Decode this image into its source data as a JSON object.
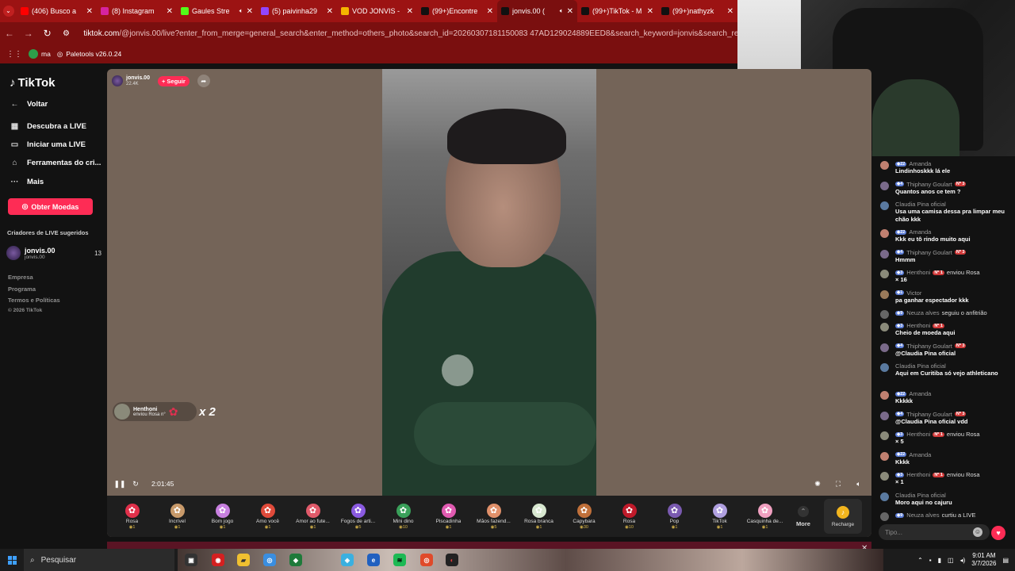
{
  "browser": {
    "tabs": [
      {
        "title": "(406) Busco a",
        "icon": "youtube-icon",
        "color": "#ff0000",
        "sound": false
      },
      {
        "title": "(8) Instagram",
        "icon": "instagram-icon",
        "color": "#d6249f",
        "sound": false
      },
      {
        "title": "Gaules Stre",
        "icon": "kick-icon",
        "color": "#53fc18",
        "sound": true
      },
      {
        "title": "(5) paivinha29",
        "icon": "twitch-icon",
        "color": "#9146ff",
        "sound": false
      },
      {
        "title": "VOD JONVIS -",
        "icon": "drive-icon",
        "color": "#f4b400",
        "sound": false
      },
      {
        "title": "(99+)Encontre",
        "icon": "tiktok-icon",
        "color": "#111111",
        "sound": false
      },
      {
        "title": "jonvis.00 (",
        "icon": "tiktok-icon",
        "color": "#111111",
        "sound": true,
        "active": true
      },
      {
        "title": "(99+)TikTok - M",
        "icon": "tiktok-icon",
        "color": "#111111",
        "sound": false
      },
      {
        "title": "(99+)nathyzk",
        "icon": "tiktok-icon",
        "color": "#111111",
        "sound": false
      }
    ],
    "url_host": "tiktok.com",
    "url_path": "/@jonvis.00/live?enter_from_merge=general_search&enter_method=others_photo&search_id=20260307181150083 47AD129024889EED8&search_keyword=jonvis&search_result_id=2422438",
    "bookmarks": [
      {
        "label": "ma",
        "color": "#2e9e4a"
      },
      {
        "label": "Paletools v26.0.24",
        "color": "#ffffff"
      }
    ]
  },
  "sidebar": {
    "brand": "TikTok",
    "nav": [
      {
        "label": "Voltar",
        "icon": "arrow-left-icon"
      },
      {
        "label": "Descubra a LIVE",
        "icon": "live-calendar-icon"
      },
      {
        "label": "Iniciar uma LIVE",
        "icon": "camera-icon"
      },
      {
        "label": "Ferramentas do cri...",
        "icon": "home-icon"
      },
      {
        "label": "Mais",
        "icon": "more-icon"
      }
    ],
    "coins_button": "Obter Moedas",
    "suggested_heading": "Criadores de LIVE sugeridos",
    "creator": {
      "name": "jonvis.00",
      "handle": "jonvis.00",
      "count": "13"
    },
    "footer": [
      "Empresa",
      "Programa",
      "Termos e Políticas",
      "© 2026 TikTok"
    ]
  },
  "live": {
    "host_name": "jonvis.00",
    "viewers": "22.4K",
    "follow_label": "+ Seguir",
    "gift_popup": {
      "user": "Henthoni",
      "text": "enviou Rosa n°",
      "multiplier": "x 2"
    },
    "elapsed": "2:01:45"
  },
  "gifts": [
    {
      "name": "Rosa",
      "price": "1",
      "icon": "rose-icon",
      "color": "#e0304a"
    },
    {
      "name": "Incrível",
      "price": "1",
      "icon": "face-icon",
      "color": "#c89a6a"
    },
    {
      "name": "Bom jogo",
      "price": "1",
      "icon": "gamepad-icon",
      "color": "#c880e0"
    },
    {
      "name": "Amo você",
      "price": "1",
      "icon": "heart-icon",
      "color": "#e04a3a"
    },
    {
      "name": "Amor ao fute...",
      "price": "1",
      "icon": "football-icon",
      "color": "#e05a6a"
    },
    {
      "name": "Fogos de arti...",
      "price": "5",
      "icon": "fireworks-icon",
      "color": "#8a5ae0"
    },
    {
      "name": "Mini dino",
      "price": "10",
      "icon": "dino-icon",
      "color": "#3aa05a"
    },
    {
      "name": "Piscadinha",
      "price": "1",
      "icon": "wink-icon",
      "color": "#e05ab0"
    },
    {
      "name": "Mãos fazend...",
      "price": "5",
      "icon": "hands-icon",
      "color": "#e0906a"
    },
    {
      "name": "Rosa branca",
      "price": "1",
      "icon": "white-rose-icon",
      "color": "#d8e8d0"
    },
    {
      "name": "Capybara",
      "price": "30",
      "icon": "capybara-icon",
      "color": "#c0703a"
    },
    {
      "name": "Rosa",
      "price": "10",
      "icon": "rose-icon",
      "color": "#c01a2a"
    },
    {
      "name": "Pop",
      "price": "1",
      "icon": "pop-icon",
      "color": "#7a5ab0"
    },
    {
      "name": "TikTok",
      "price": "1",
      "icon": "tiktok-icon",
      "color": "#b0a0e0"
    },
    {
      "name": "Casquinha de...",
      "price": "1",
      "icon": "icecream-icon",
      "color": "#f0a0c0"
    }
  ],
  "gift_more": "More",
  "recharge": "Recharge",
  "chat": [
    {
      "lvl": "22",
      "user": "Amanda",
      "badge": "",
      "text": "Lindinhoskkk lá ele",
      "action": ""
    },
    {
      "lvl": "4",
      "user": "Thiphany Goulart",
      "badge": "Nº 3",
      "text": "Quantos anos ce tem ?",
      "action": ""
    },
    {
      "lvl": "",
      "user": "Claudia Pina oficial",
      "badge": "",
      "text": "Usa uma camisa dessa pra limpar meu chão kkk",
      "action": ""
    },
    {
      "lvl": "22",
      "user": "Amanda",
      "badge": "",
      "text": "Kkk eu tô rindo muito aqui",
      "action": ""
    },
    {
      "lvl": "4",
      "user": "Thiphany Goulart",
      "badge": "Nº 3",
      "text": "Hmmm",
      "action": ""
    },
    {
      "lvl": "3",
      "user": "Henthoni",
      "badge": "Nº 1",
      "text": "× 16",
      "action": "enviou Rosa"
    },
    {
      "lvl": "1",
      "user": "Victor",
      "badge": "",
      "text": "pa ganhar espectador kkk",
      "action": ""
    },
    {
      "lvl": "9",
      "user": "Neuza alves",
      "badge": "",
      "text": "",
      "action": "seguiu o anfitrião"
    },
    {
      "lvl": "3",
      "user": "Henthoni",
      "badge": "Nº 1",
      "text": "Cheio de moeda aqui",
      "action": ""
    },
    {
      "lvl": "4",
      "user": "Thiphany Goulart",
      "badge": "Nº 3",
      "text": "@Claudia Pina oficial",
      "action": ""
    },
    {
      "lvl": "",
      "user": "Claudia Pina oficial",
      "badge": "",
      "text": "Aqui em Curitiba só vejo athleticano",
      "action": ""
    },
    {
      "lvl": "22",
      "user": "Amanda",
      "badge": "",
      "text": "Kkkkk",
      "action": ""
    },
    {
      "lvl": "4",
      "user": "Thiphany Goulart",
      "badge": "Nº 3",
      "text": "@Claudia Pina oficial vdd",
      "action": ""
    },
    {
      "lvl": "3",
      "user": "Henthoni",
      "badge": "Nº 1",
      "text": "× 5",
      "action": "enviou Rosa"
    },
    {
      "lvl": "22",
      "user": "Amanda",
      "badge": "",
      "text": "Kkkk",
      "action": ""
    },
    {
      "lvl": "3",
      "user": "Henthoni",
      "badge": "Nº 1",
      "text": "× 1",
      "action": "enviou Rosa"
    },
    {
      "lvl": "",
      "user": "Claudia Pina oficial",
      "badge": "",
      "text": "Moro aqui no cajuru",
      "action": ""
    },
    {
      "lvl": "9",
      "user": "Neuza alves",
      "badge": "",
      "text": "",
      "action": "curtiu a LIVE"
    }
  ],
  "chat_placeholder": "Tipo...",
  "taskbar": {
    "search": "Pesquisar",
    "time": "9:01 AM",
    "date": "3/7/2026"
  }
}
